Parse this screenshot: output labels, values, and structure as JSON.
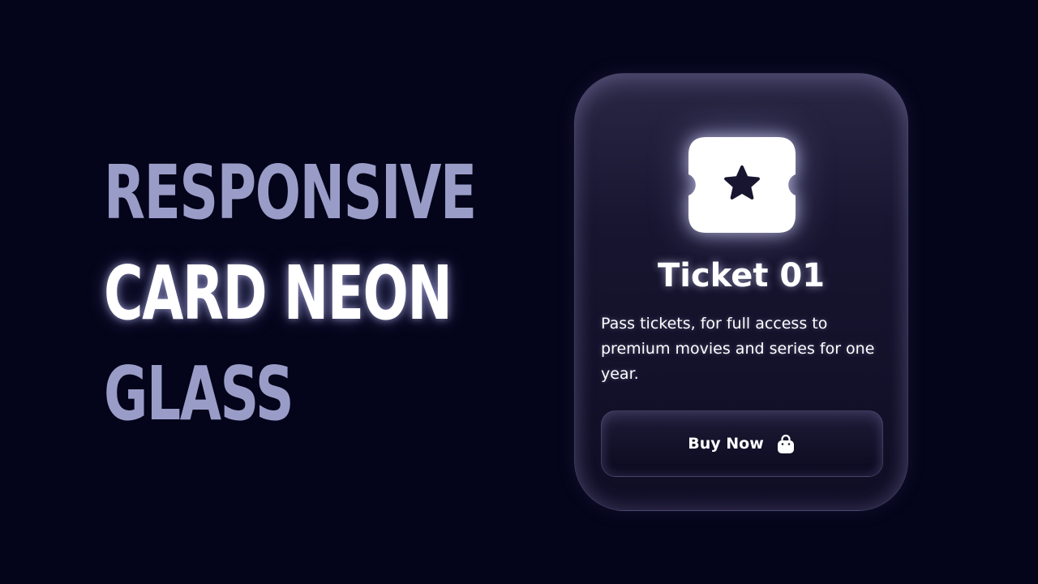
{
  "headline": {
    "line1": "RESPONSIVE",
    "line2": "CARD NEON",
    "line3": "GLASS"
  },
  "card": {
    "title": "Ticket 01",
    "description": "Pass tickets, for full access to premium movies and series for one year.",
    "button_label": "Buy Now",
    "icon": "ticket-star-icon",
    "button_icon": "shopping-bag-icon"
  },
  "colors": {
    "background": "#04041a",
    "headline_dim": "#9a9cc8",
    "headline_glow": "#ffffff",
    "card_surface": "#17152f"
  }
}
